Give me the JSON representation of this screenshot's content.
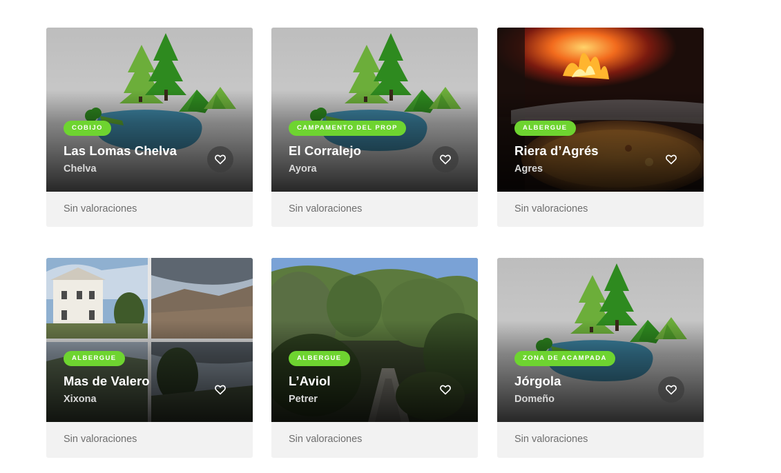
{
  "colors": {
    "badge": "#6ed430",
    "footer": "#f2f2f2",
    "rating_text": "#6e6e6e"
  },
  "listings": [
    {
      "category": "Cobijo",
      "title": "Las Lomas Chelva",
      "location": "Chelva",
      "rating": "Sin valoraciones",
      "image": "placeholder-forest-illustration",
      "fav_icon": "heart-outline-icon"
    },
    {
      "category": "Campamento del prop",
      "title": "El Corralejo",
      "location": "Ayora",
      "rating": "Sin valoraciones",
      "image": "placeholder-forest-illustration",
      "fav_icon": "heart-outline-icon"
    },
    {
      "category": "Albergue",
      "title": "Riera d’Agrés",
      "location": "Agres",
      "rating": "Sin valoraciones",
      "image": "photo-fireplace-paella",
      "fav_icon": "heart-outline-icon"
    },
    {
      "category": "Albergue",
      "title": "Mas de Valero",
      "location": "Xixona",
      "rating": "Sin valoraciones",
      "image": "photo-collage-house-landscape",
      "fav_icon": "heart-outline-icon"
    },
    {
      "category": "Albergue",
      "title": "L’Aviol",
      "location": "Petrer",
      "rating": "Sin valoraciones",
      "image": "photo-forest-path",
      "fav_icon": "heart-outline-icon"
    },
    {
      "category": "Zona de acampada",
      "title": "Jórgola",
      "location": "Domeño",
      "rating": "Sin valoraciones",
      "image": "placeholder-forest-illustration",
      "fav_icon": "heart-outline-icon"
    }
  ]
}
